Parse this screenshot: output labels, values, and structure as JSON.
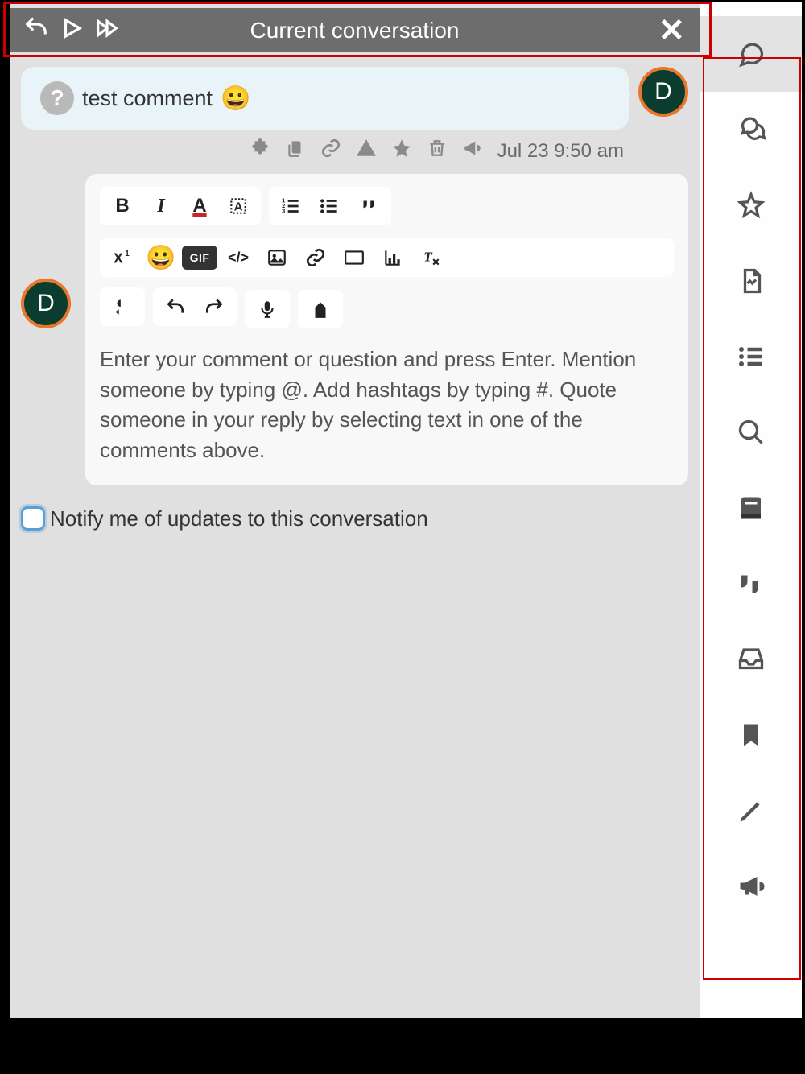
{
  "header": {
    "title": "Current conversation"
  },
  "comment": {
    "text": "test comment ",
    "emoji": "😀",
    "avatar_letter": "D",
    "help_mark": "?",
    "timestamp": "Jul 23 9:50 am"
  },
  "editor": {
    "avatar_letter": "D",
    "placeholder": "Enter your comment or question and press Enter. Mention someone by typing @. Add hashtags by typing #. Quote someone in your reply by selecting text in one of the comments above.",
    "toolbar": {
      "bold": "B",
      "italic": "I",
      "text_color": "A",
      "gif": "GIF",
      "code": "</>",
      "emoji": "😀"
    }
  },
  "notify": {
    "label": "Notify me of updates to this conversation"
  },
  "side": {
    "items": [
      "comment-icon",
      "comments-icon",
      "star-icon",
      "image-icon",
      "list-icon",
      "search-icon",
      "address-book-icon",
      "quotes-icon",
      "inbox-icon",
      "bookmark-icon",
      "pencil-icon",
      "megaphone-icon"
    ]
  }
}
